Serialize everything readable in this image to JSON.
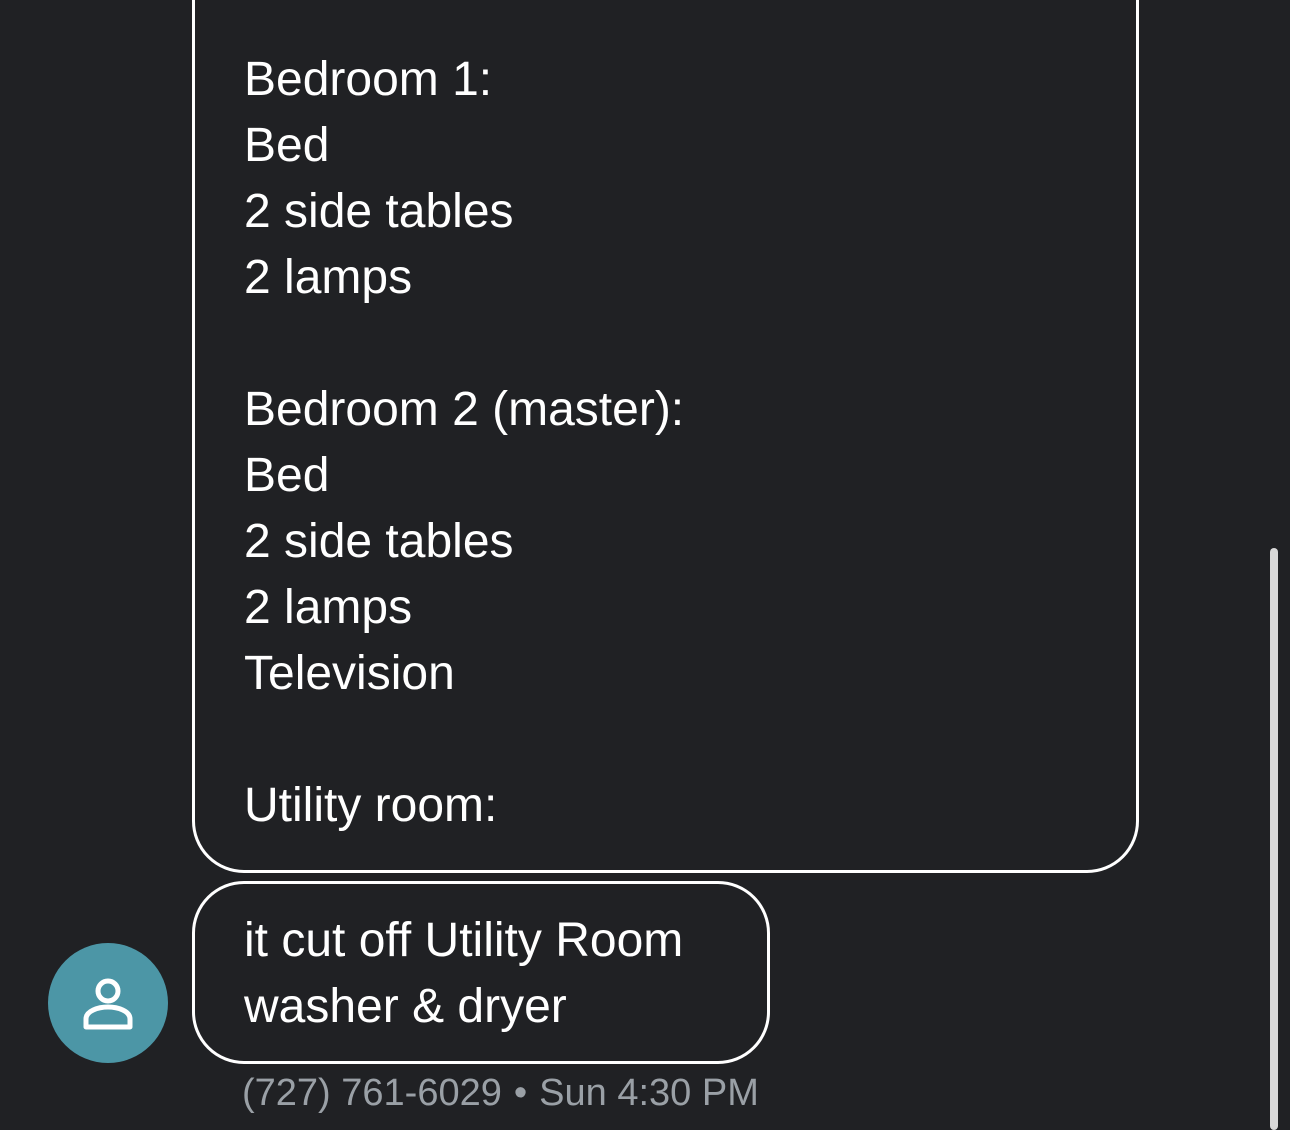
{
  "messages": [
    {
      "lines": [
        "Bedroom 1:",
        "Bed",
        "2 side tables",
        "2 lamps",
        "",
        "Bedroom 2 (master):",
        "Bed",
        "2 side tables",
        "2 lamps",
        "Television",
        "",
        "Utility room:"
      ]
    },
    {
      "lines": [
        "it cut off Utility Room",
        "washer & dryer"
      ]
    }
  ],
  "sender": {
    "phone": "(727) 761-6029",
    "separator": "•",
    "time": "Sun 4:30 PM",
    "avatar_icon": "person-icon",
    "avatar_color": "#4c96a6"
  },
  "theme": {
    "background": "#202124",
    "bubble_border": "#ffffff",
    "text": "#ffffff",
    "meta_text": "#9aa0a6"
  }
}
